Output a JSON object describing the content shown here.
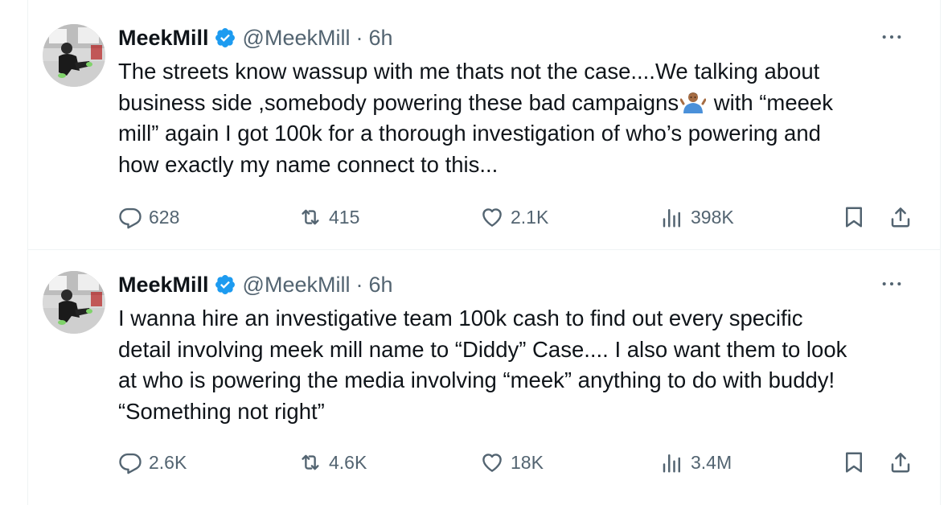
{
  "tweets": [
    {
      "author": {
        "name": "MeekMill",
        "handle": "@MeekMill",
        "time": "6h",
        "separator": "·"
      },
      "text_lines": [
        "The streets know wassup with me thats not the case....We talking about",
        "business side ,somebody powering these bad campaigns",
        " with “meeek",
        "mill” again I got 100k for a thorough investigation of who’s powering and",
        "how exactly my name connect to this..."
      ],
      "emoji": "man-shrugging-emoji",
      "stats": {
        "replies": "628",
        "reposts": "415",
        "likes": "2.1K",
        "views": "398K"
      }
    },
    {
      "author": {
        "name": "MeekMill",
        "handle": "@MeekMill",
        "time": "6h",
        "separator": "·"
      },
      "text_lines": [
        "I wanna hire an investigative team 100k cash to find out every specific",
        "detail involving meek mill name to “Diddy” Case.... I also want them to look",
        "at who is powering the media involving “meek” anything to do with buddy!",
        "“Something not right”"
      ],
      "stats": {
        "replies": "2.6K",
        "reposts": "4.6K",
        "likes": "18K",
        "views": "3.4M"
      }
    }
  ],
  "icons": {
    "verified": "verified-badge-icon",
    "more": "more-options-icon",
    "reply": "reply-icon",
    "repost": "repost-icon",
    "like": "like-icon",
    "views": "views-icon",
    "bookmark": "bookmark-icon",
    "share": "share-icon"
  },
  "colors": {
    "verified": "#1d9bf0",
    "muted": "#536471",
    "text": "#0f1419",
    "divider": "#eff3f4"
  }
}
